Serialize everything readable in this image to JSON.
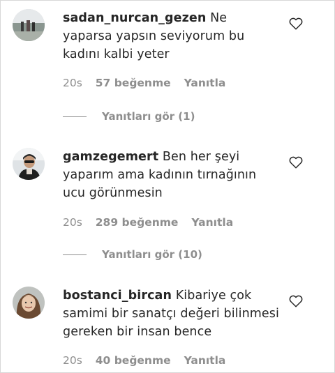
{
  "comments": [
    {
      "username": "sadan_nurcan_gezen",
      "text": "Ne yaparsa yapsın seviyorum bu kadını kalbi yeter",
      "time": "20s",
      "likes": "57 beğenme",
      "reply_label": "Yanıtla",
      "view_replies": "Yanıtları gör (1)",
      "avatar": "landscape-photo-avatar"
    },
    {
      "username": "gamzegemert",
      "text": "Ben her şeyi yaparım ama kadının tırnağının ucu görünmesin",
      "time": "20s",
      "likes": "289 beğenme",
      "reply_label": "Yanıtla",
      "view_replies": "Yanıtları gör (10)",
      "avatar": "person-photo-avatar"
    },
    {
      "username": "bostanci_bircan",
      "text": "Kibariye çok samimi bir sanatçı değeri bilinmesi gereken bir insan bence",
      "time": "20s",
      "likes": "40 beğenme",
      "reply_label": "Yanıtla",
      "avatar": "person-photo-avatar"
    }
  ],
  "icons": {
    "like": "heart-outline-icon"
  },
  "colors": {
    "text": "#262626",
    "secondary": "#8e8e8e",
    "background": "#ffffff"
  }
}
